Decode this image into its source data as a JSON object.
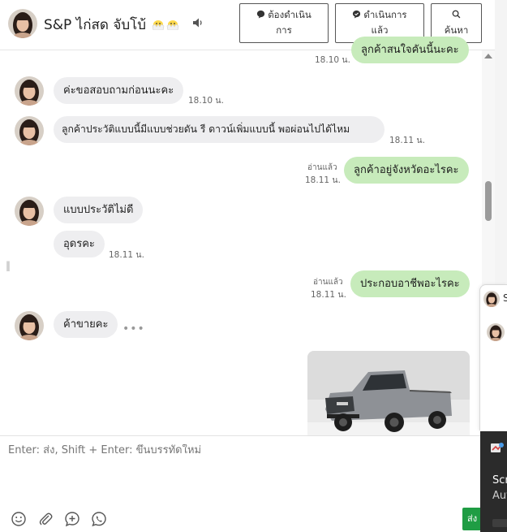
{
  "header": {
    "contact_name": "S&P ไก่สด จับโบ้",
    "buttons": {
      "todo": [
        "ต้องดำเนิน",
        "การ"
      ],
      "done": [
        "ดำเนินการ",
        "แล้ว"
      ],
      "search": "ค้นหา"
    }
  },
  "messages": [
    {
      "direction": "out",
      "text": "ลูกค้าสนใจคันนี้นะคะ",
      "time": "18.10 น."
    },
    {
      "direction": "in",
      "text": "ค่ะขอสอบถามก่อนนะคะ",
      "time": "18.10 น."
    },
    {
      "direction": "in",
      "text": "ลูกค้าประวัติแบบนี้มีแบบช่วยดัน รี ดาวน์เพิ่มแบบนี้ พอผ่อนไปได้ไหม",
      "time": "18.11 น."
    },
    {
      "direction": "out",
      "text": "ลูกค้าอยู่จังหวัดอะไรคะ",
      "time": "18.11 น.",
      "status": "อ่านแล้ว"
    },
    {
      "direction": "in",
      "text": "แบบประวัติไม่ดี",
      "time": ""
    },
    {
      "direction": "in",
      "text": "อุดรคะ",
      "time": "18.11 น."
    },
    {
      "direction": "out",
      "text": "ประกอบอาชีพอะไรคะ",
      "time": "18.11 น.",
      "status": "อ่านแล้ว"
    },
    {
      "direction": "in",
      "text": "ค้าขายคะ",
      "time": "",
      "more": "•••"
    }
  ],
  "composer": {
    "placeholder": "Enter: ส่ง, Shift + Enter: ขึ้นบรรทัดใหม่",
    "send_label": "ส่ง",
    "tools": [
      "emoji-icon",
      "attach-icon",
      "add-icon",
      "whatsapp-icon"
    ]
  },
  "side_panel": {
    "initial": "S"
  },
  "toast": {
    "line1": "Scr",
    "line2": "Aut"
  },
  "colors": {
    "outgoing": "#c7ebbb",
    "incoming": "#eeeef0",
    "send": "#1f9d44",
    "toast": "#2b2b2b"
  }
}
